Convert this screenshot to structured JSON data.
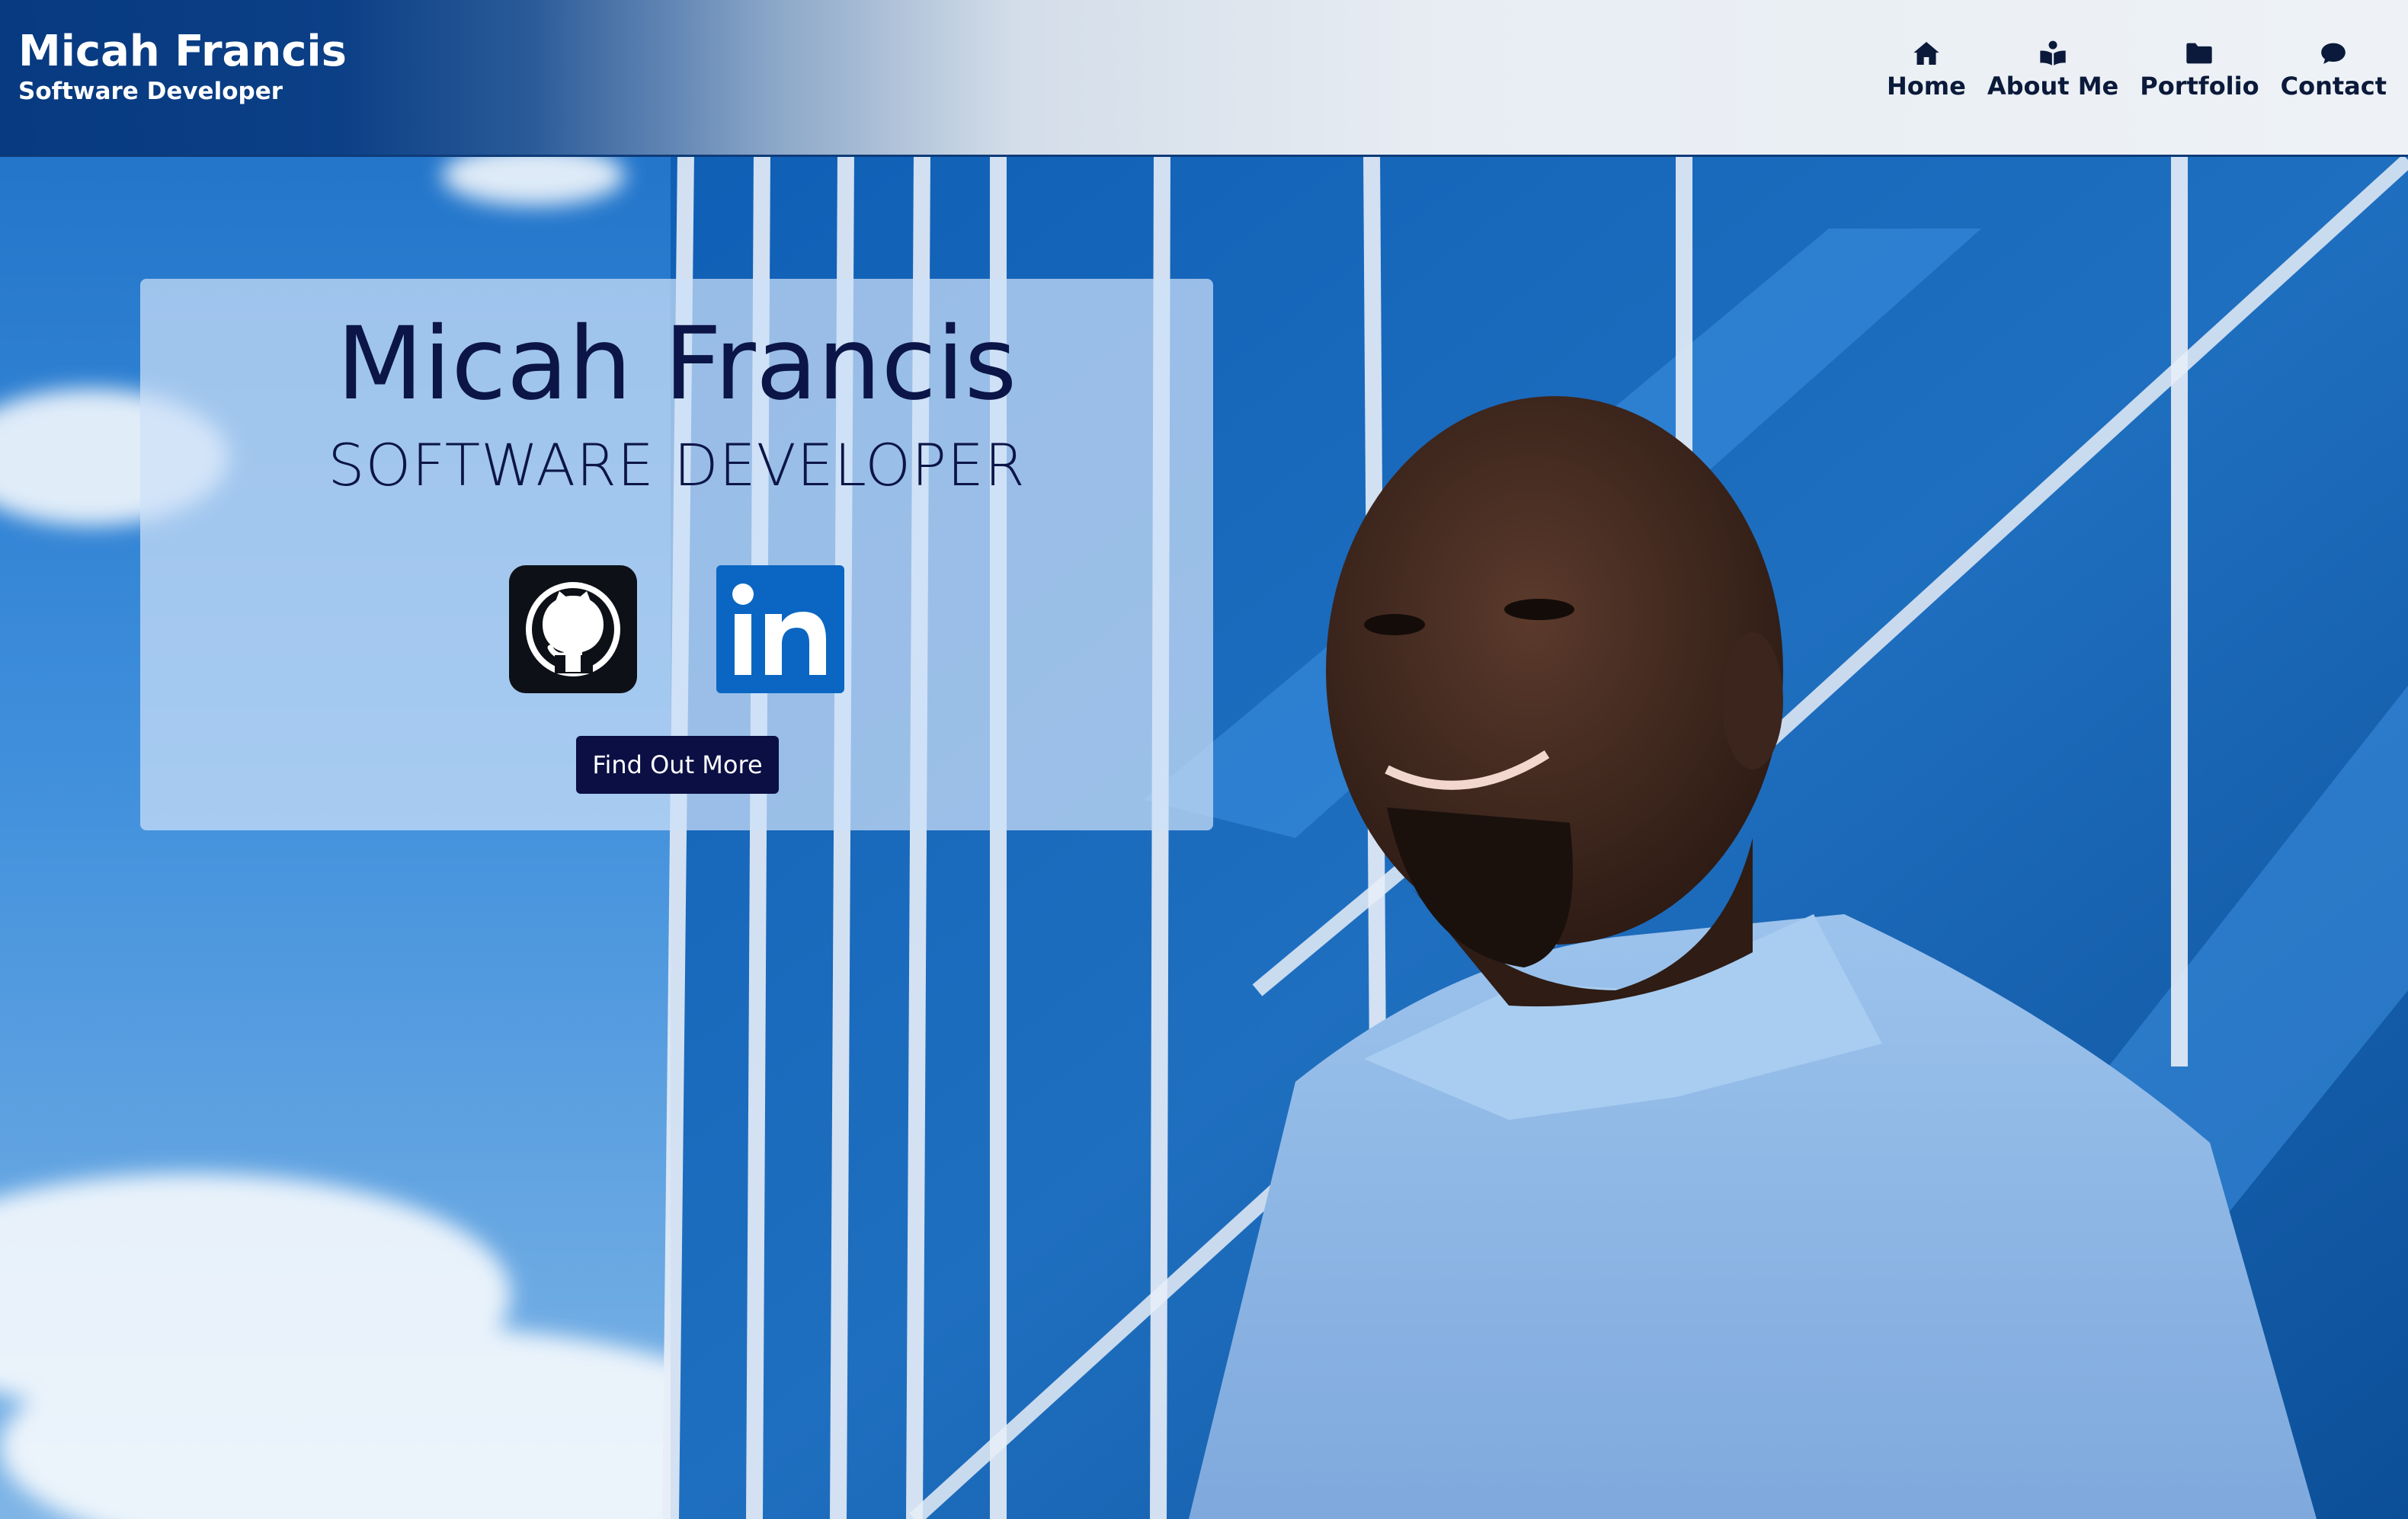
{
  "header": {
    "brand_name": "Micah Francis",
    "brand_tagline": "Software Developer"
  },
  "nav": {
    "items": [
      {
        "label": "Home",
        "icon": "home-icon"
      },
      {
        "label": "About Me",
        "icon": "reader-icon"
      },
      {
        "label": "Portfolio",
        "icon": "folder-icon"
      },
      {
        "label": "Contact",
        "icon": "chat-bubble-icon"
      }
    ]
  },
  "intro": {
    "name": "Micah Francis",
    "role": "SOFTWARE DEVELOPER",
    "social": [
      {
        "icon": "github-icon"
      },
      {
        "icon": "linkedin-icon"
      }
    ],
    "cta_label": "Find Out More"
  },
  "colors": {
    "header_dark": "#073a80",
    "card_text": "#0c1547",
    "cta_bg": "#0b0f44",
    "github": "#0d1117",
    "linkedin": "#0a66c2"
  }
}
